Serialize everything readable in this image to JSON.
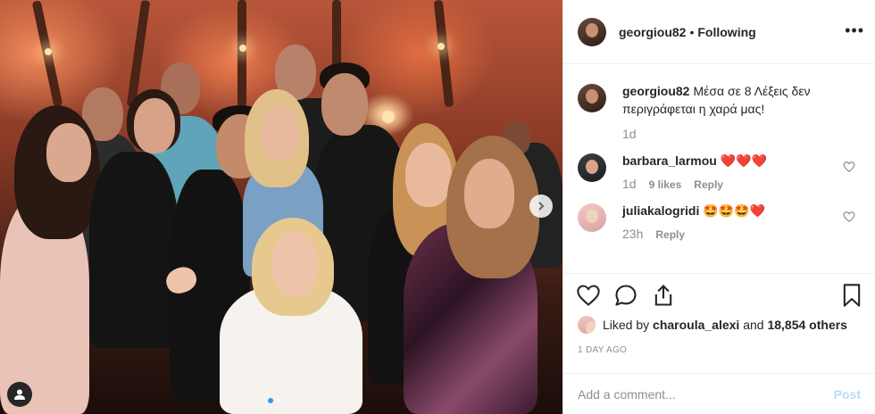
{
  "post": {
    "photo_alt": "Group photo",
    "next_icon": "chevron-right-icon",
    "tag_icon": "user-tag-icon"
  },
  "header": {
    "username": "georgiou82",
    "separator": "•",
    "follow_status": "Following",
    "more": "•••"
  },
  "caption": {
    "username": "georgiou82",
    "text": "Μέσα σε 8 Λέξεις δεν περιγράφεται η χαρά μας!",
    "time": "1d"
  },
  "comments": [
    {
      "username": "barbara_larmou",
      "text": "❤️❤️❤️",
      "time": "1d",
      "likes": "9 likes",
      "reply": "Reply"
    },
    {
      "username": "juliakalogridi",
      "text": "🤩🤩🤩❤️",
      "time": "23h",
      "reply": "Reply"
    }
  ],
  "likes": {
    "prefix": "Liked by",
    "user": "charoula_alexi",
    "conjunction": "and",
    "others": "18,854 others"
  },
  "timestamp": "1 DAY AGO",
  "add_comment": {
    "placeholder": "Add a comment...",
    "post_label": "Post"
  },
  "colors": {
    "link_blue": "#3897f0",
    "post_disabled": "#b2dffc",
    "heart_red": "#ed4956"
  }
}
